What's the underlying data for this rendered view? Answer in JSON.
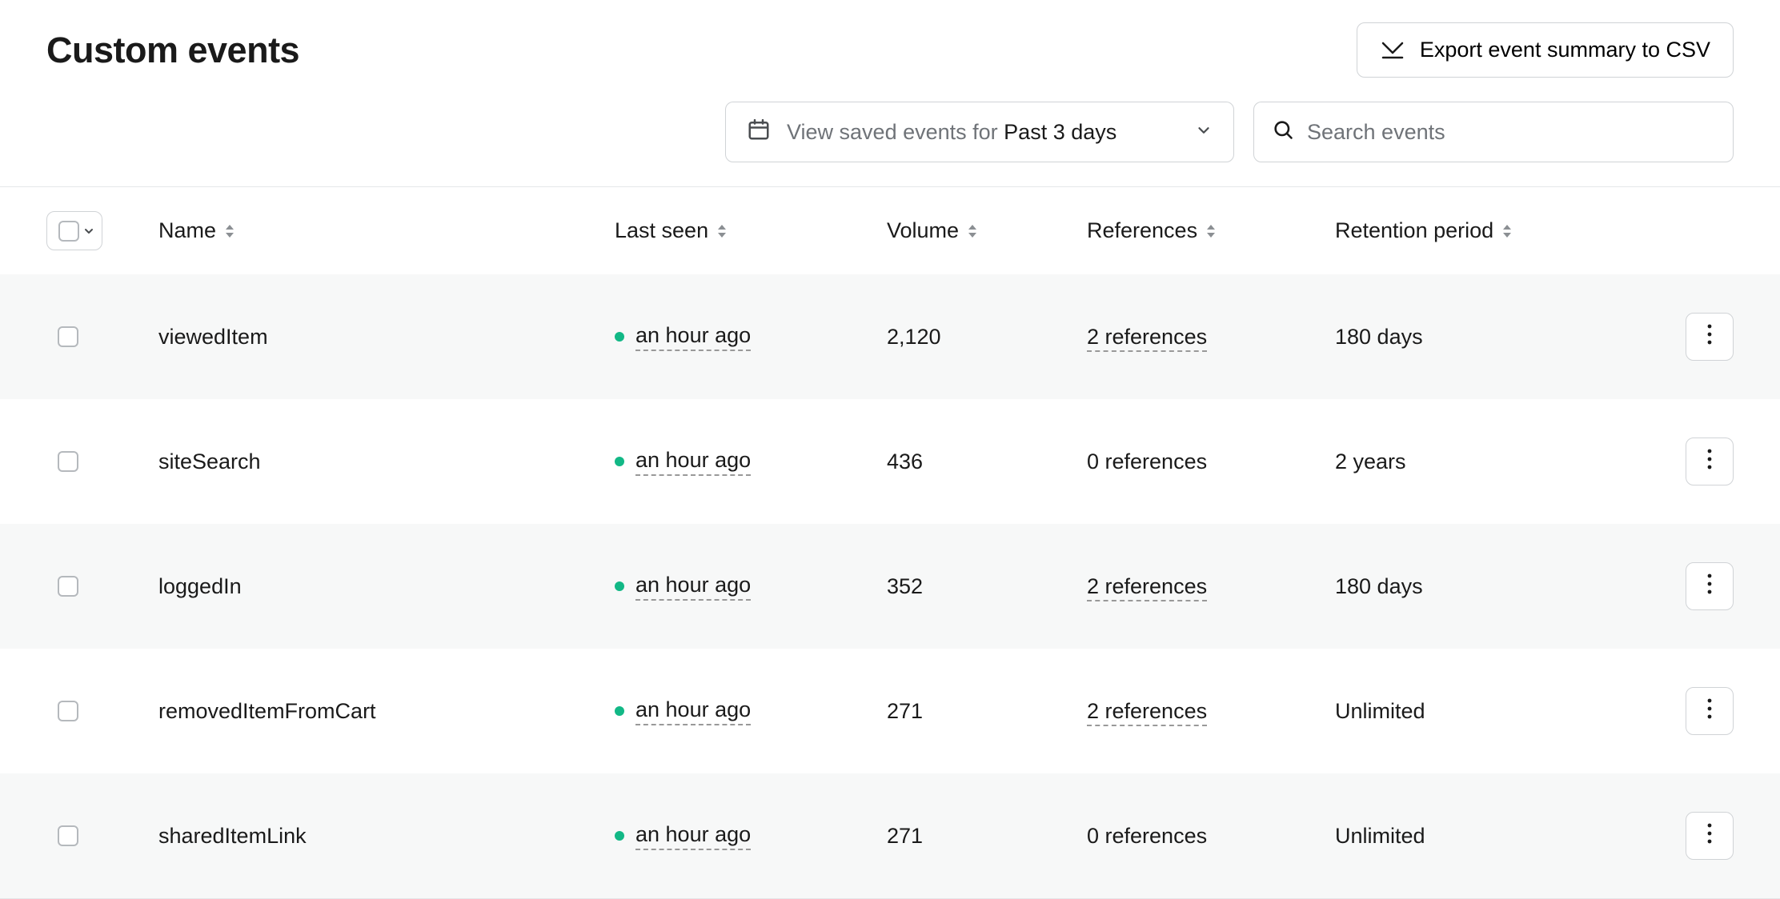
{
  "header": {
    "title": "Custom events",
    "export_label": "Export event summary to CSV"
  },
  "controls": {
    "dropdown_prefix": "View saved events for",
    "dropdown_value": "Past 3 days",
    "search_placeholder": "Search events"
  },
  "table": {
    "columns": {
      "name": "Name",
      "last_seen": "Last seen",
      "volume": "Volume",
      "references": "References",
      "retention": "Retention period"
    },
    "rows": [
      {
        "name": "viewedItem",
        "last_seen": "an hour ago",
        "volume": "2,120",
        "references": "2 references",
        "references_link": true,
        "retention": "180 days"
      },
      {
        "name": "siteSearch",
        "last_seen": "an hour ago",
        "volume": "436",
        "references": "0 references",
        "references_link": false,
        "retention": "2 years"
      },
      {
        "name": "loggedIn",
        "last_seen": "an hour ago",
        "volume": "352",
        "references": "2 references",
        "references_link": true,
        "retention": "180 days"
      },
      {
        "name": "removedItemFromCart",
        "last_seen": "an hour ago",
        "volume": "271",
        "references": "2 references",
        "references_link": true,
        "retention": "Unlimited"
      },
      {
        "name": "sharedItemLink",
        "last_seen": "an hour ago",
        "volume": "271",
        "references": "0 references",
        "references_link": false,
        "retention": "Unlimited"
      }
    ]
  },
  "colors": {
    "status_dot": "#12b886",
    "border": "#d0d3d6",
    "muted_text": "#6f7378",
    "row_alt": "#f7f8f8"
  }
}
